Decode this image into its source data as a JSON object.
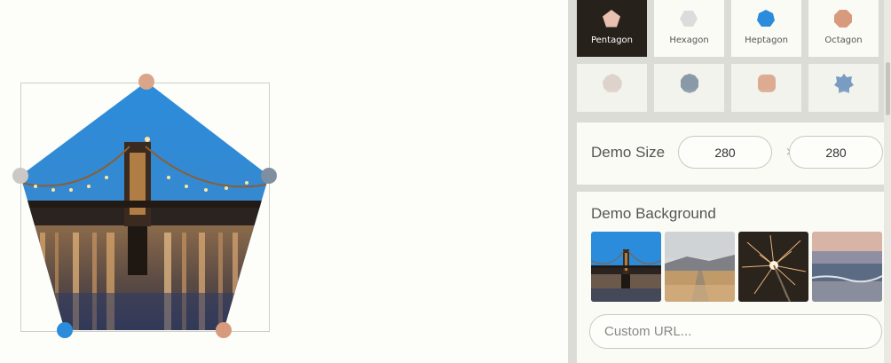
{
  "colors": {
    "shape_fill": "#2b8cdc",
    "handle_top": "#d9a68a",
    "handle_left": "#cbc8c6",
    "handle_right": "#7d8fa0",
    "handle_bottom_left": "#2b8cdc",
    "handle_bottom_right": "#d79a7c",
    "active_tile_bg": "#27211b"
  },
  "demo": {
    "shape": "pentagon",
    "background": "bridge-night-photo"
  },
  "shapes": {
    "tiles": [
      {
        "label": "Pentagon",
        "icon": "pentagon-icon",
        "color": "#e8c1b0",
        "active": true
      },
      {
        "label": "Hexagon",
        "icon": "hexagon-icon",
        "color": "#dcdcdc",
        "active": false
      },
      {
        "label": "Heptagon",
        "icon": "heptagon-icon",
        "color": "#2b8cdc",
        "active": false
      },
      {
        "label": "Octagon",
        "icon": "octagon-icon",
        "color": "#d79a7c",
        "active": false
      }
    ],
    "faded_tiles": [
      {
        "icon": "nonagon-icon",
        "color": "#d8ccc4"
      },
      {
        "icon": "decagon-icon",
        "color": "#6f8396"
      },
      {
        "icon": "rounded-square-icon",
        "color": "#d79a7c"
      },
      {
        "icon": "star-shape-icon",
        "color": "#5d87b8"
      }
    ]
  },
  "size": {
    "title": "Demo Size",
    "width": "280",
    "height": "280",
    "separator": "×"
  },
  "background": {
    "title": "Demo Background",
    "thumbnails": [
      {
        "name": "bridge-thumbnail"
      },
      {
        "name": "desert-road-thumbnail"
      },
      {
        "name": "sparkler-thumbnail"
      },
      {
        "name": "beach-sunset-thumbnail"
      }
    ],
    "custom_url_placeholder": "Custom URL..."
  }
}
